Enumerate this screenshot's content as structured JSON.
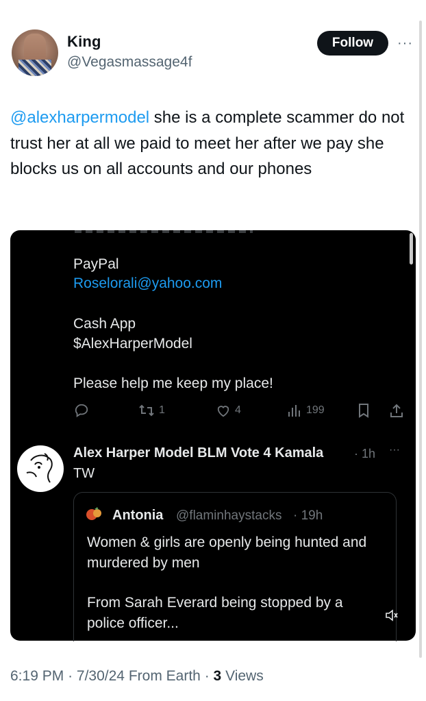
{
  "tweet": {
    "author_name": "King",
    "author_handle": "@Vegasmassage4f",
    "follow_label": "Follow",
    "more_label": "···",
    "mention": "@alexharpermodel",
    "body": " she is a complete scammer do not trust her at all we paid to meet her after we pay she blocks us on all accounts and our phones",
    "time": "6:19 PM",
    "date": "7/30/24",
    "location": "From Earth",
    "views_count": "3",
    "views_label": "Views",
    "separator": "·"
  },
  "media": {
    "post_lines": {
      "paypal_label": "PayPal",
      "paypal_email": "Roselorali@yahoo.com",
      "cashapp_label": "Cash App",
      "cashapp_tag": "$AlexHarperModel",
      "plea": "Please help me keep my place!"
    },
    "actions": {
      "retweets": "1",
      "likes": "4",
      "views": "199"
    },
    "reply": {
      "name": "Alex Harper Model BLM Vote 4 Kamala",
      "time": "· 1h",
      "text": "TW",
      "more": "···"
    },
    "quote": {
      "name": "Antonia",
      "handle": "@flaminhaystacks",
      "time": "· 19h",
      "text1": "Women & girls are openly being hunted and murdered by men",
      "text2": "From Sarah Everard being stopped by a police officer..."
    }
  }
}
